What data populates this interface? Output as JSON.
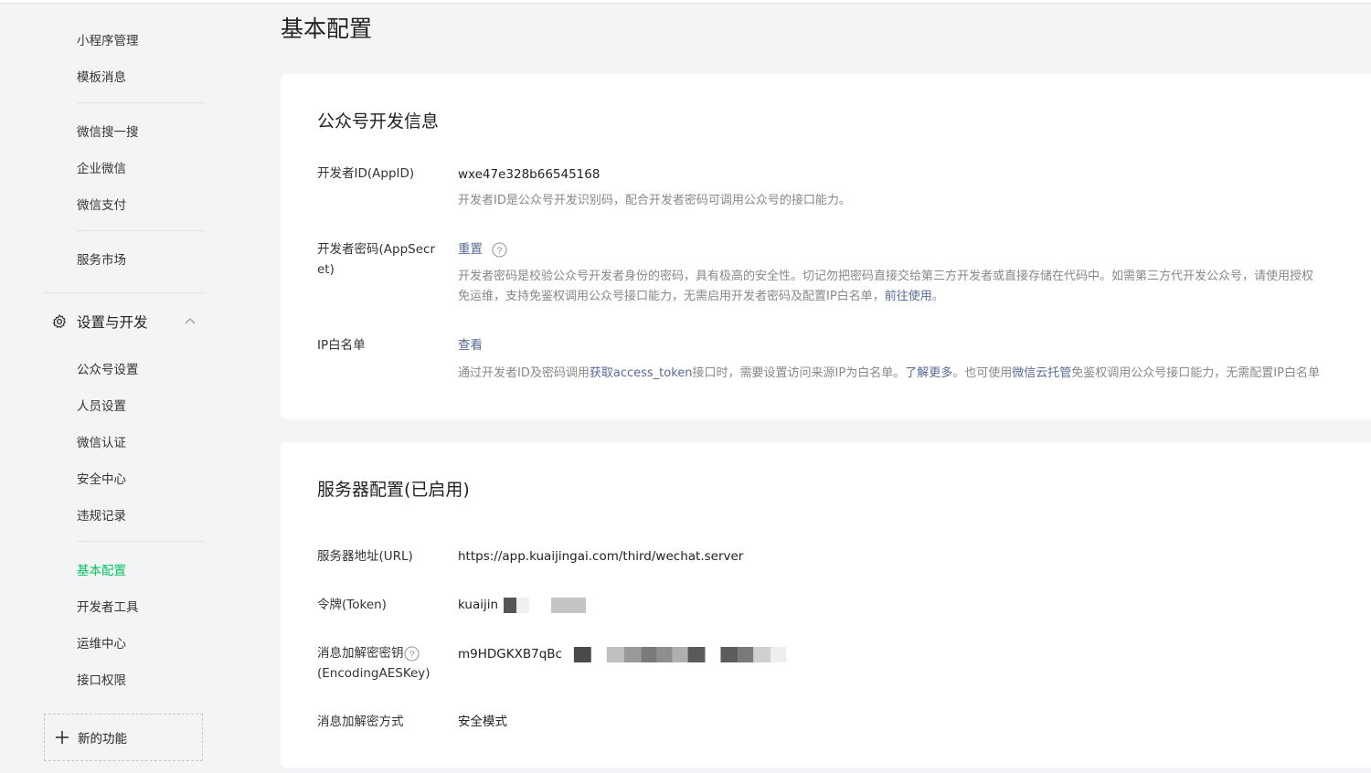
{
  "sidebar": {
    "items_top": [
      {
        "label": "小程序管理"
      },
      {
        "label": "模板消息"
      },
      {
        "label": "微信搜一搜"
      },
      {
        "label": "企业微信"
      },
      {
        "label": "微信支付"
      },
      {
        "label": "服务市场"
      }
    ],
    "section": {
      "label": "设置与开发",
      "icon": "gear-icon",
      "expanded": true
    },
    "items_sub": [
      {
        "label": "公众号设置"
      },
      {
        "label": "人员设置"
      },
      {
        "label": "微信认证"
      },
      {
        "label": "安全中心"
      },
      {
        "label": "违规记录"
      },
      {
        "label": "基本配置",
        "active": true
      },
      {
        "label": "开发者工具"
      },
      {
        "label": "运维中心"
      },
      {
        "label": "接口权限"
      }
    ],
    "new_function": {
      "label": "新的功能",
      "icon": "plus-icon"
    },
    "active_color": "#07c160"
  },
  "main": {
    "title": "基本配置",
    "dev_info": {
      "title": "公众号开发信息",
      "appid": {
        "label": "开发者ID(AppID)",
        "value": "wxe47e328b66545168",
        "desc": "开发者ID是公众号开发识别码，配合开发者密码可调用公众号的接口能力。"
      },
      "appsecret": {
        "label": "开发者密码(AppSecret)",
        "action": "重置",
        "desc_line1": "开发者密码是校验公众号开发者身份的密码，具有极高的安全性。切记勿把密码直接交给第三方开发者或直接存储在代码中。如需第三方代开发公众号，请使用授权",
        "desc_line2_pre": "免运维，支持免鉴权调用公众号接口能力，无需启用开发者密码及配置IP白名单，",
        "desc_line2_link": "前往使用",
        "desc_line2_post": "。"
      },
      "ip_whitelist": {
        "label": "IP白名单",
        "action": "查看",
        "desc_pre": "通过开发者ID及密码调用",
        "desc_link1": "获取access_token",
        "desc_mid1": "接口时，需要设置访问来源IP为白名单。",
        "desc_link2": "了解更多",
        "desc_mid2": "。也可使用",
        "desc_link3": "微信云托管",
        "desc_post": "免鉴权调用公众号接口能力，无需配置IP白名单"
      }
    },
    "server_config": {
      "title": "服务器配置(已启用)",
      "url": {
        "label": "服务器地址(URL)",
        "value": "https://app.kuaijingai.com/third/wechat.server"
      },
      "token": {
        "label": "令牌(Token)",
        "value": "kuaijin"
      },
      "aes_key": {
        "label_line1": "消息加解密密钥",
        "label_line2": "(EncodingAESKey)",
        "value": "m9HDGKXB7qBc"
      },
      "mode": {
        "label": "消息加解密方式",
        "value": "安全模式"
      }
    }
  },
  "colors": {
    "link": "#576b95",
    "background": "#f3f4f5",
    "card": "#ffffff"
  }
}
